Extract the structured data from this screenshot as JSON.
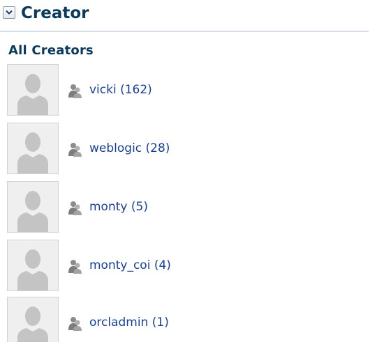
{
  "panel": {
    "header_title": "Creator",
    "section_title": "All Creators"
  },
  "creators": [
    {
      "label": "vicki (162)"
    },
    {
      "label": "weblogic (28)"
    },
    {
      "label": "monty (5)"
    },
    {
      "label": "monty_coi (4)"
    },
    {
      "label": "orcladmin (1)"
    }
  ],
  "icons": {
    "collapse_toggle": "chevron-down-icon",
    "avatar": "default-avatar-icon",
    "user": "user-icon"
  },
  "colors": {
    "heading": "#0b3a5b",
    "link": "#1a3f8c",
    "divider": "#d6dde4",
    "avatar_bg": "#efefef",
    "avatar_silhouette": "#c4c4c4"
  }
}
